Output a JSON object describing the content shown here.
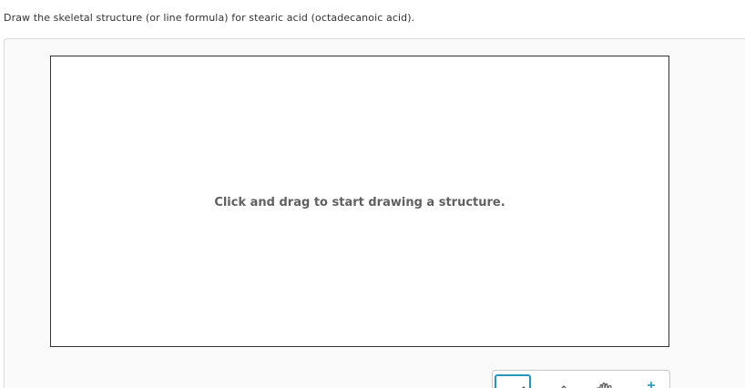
{
  "question": {
    "text": "Draw the skeletal structure (or line formula) for stearic acid (octadecanoic acid)."
  },
  "canvas": {
    "hint": "Click and drag to start drawing a structure."
  },
  "toolbar": {
    "tools": [
      {
        "icon": "pencil-icon",
        "active": true
      },
      {
        "icon": "eraser-icon",
        "active": false
      },
      {
        "icon": "hand-icon",
        "active": false
      },
      {
        "icon": "charge-icon",
        "active": false
      }
    ],
    "accent_color": "#2596be"
  }
}
